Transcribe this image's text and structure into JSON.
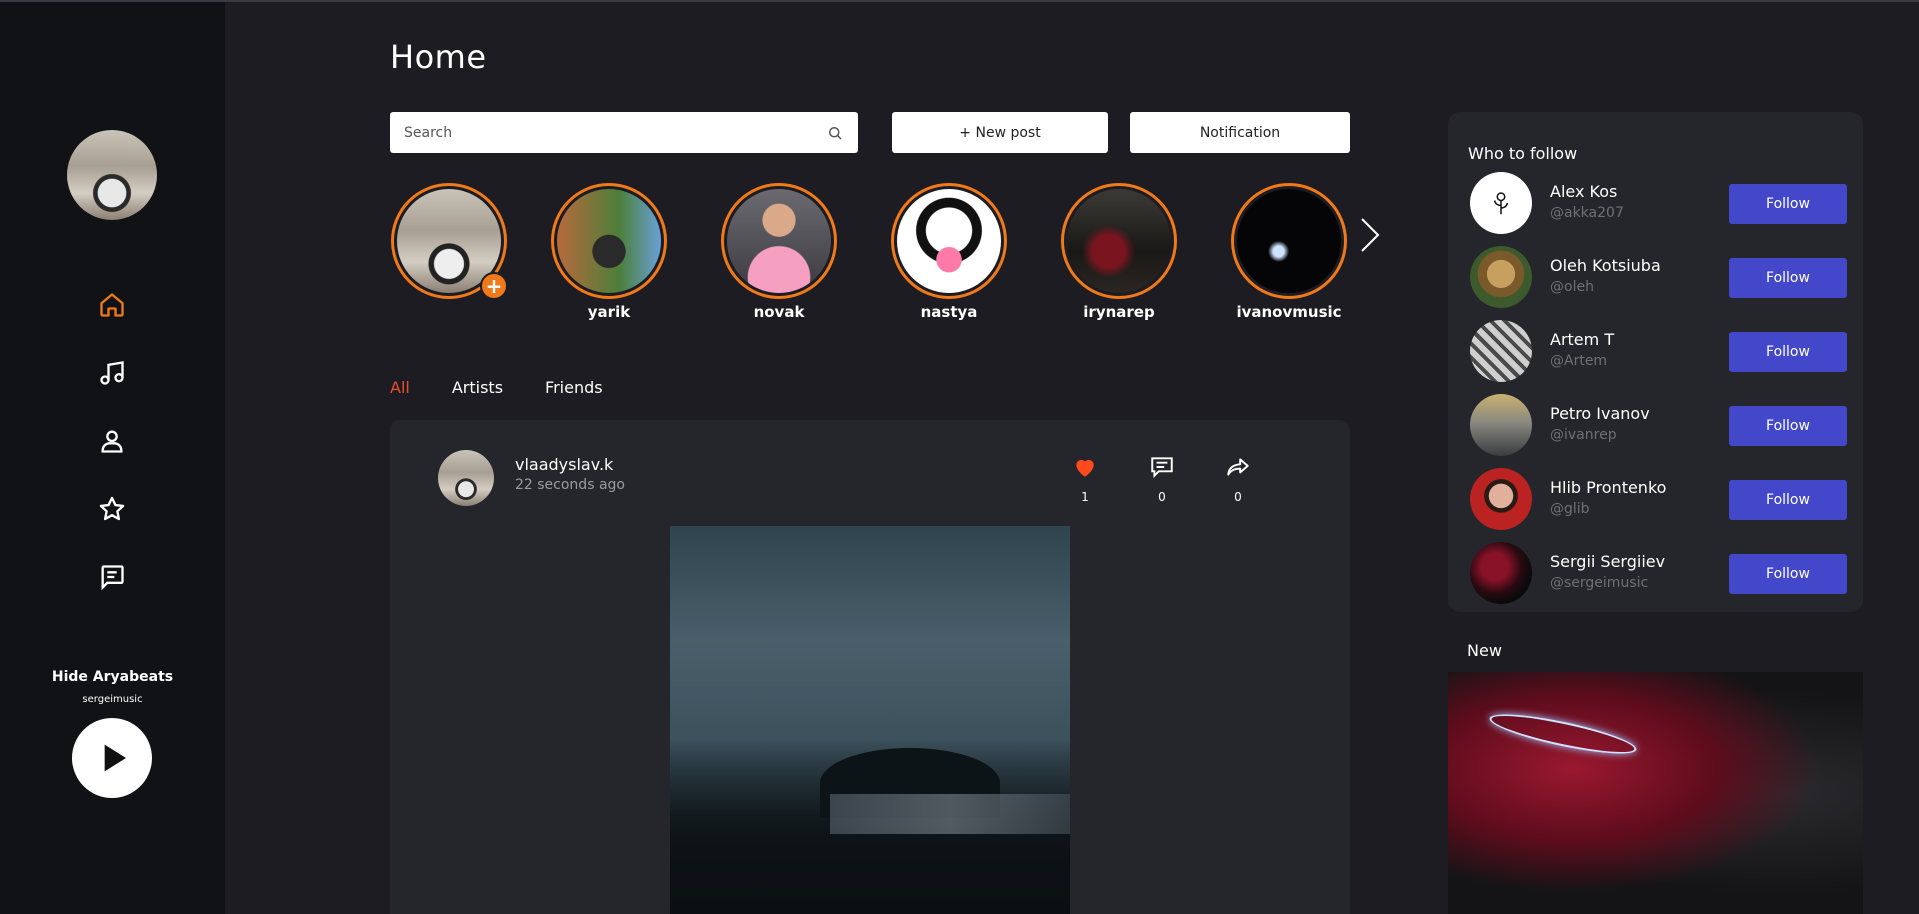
{
  "sidebar": {
    "nav": [
      {
        "icon": "home-icon",
        "active": true
      },
      {
        "icon": "music-note-icon",
        "active": false
      },
      {
        "icon": "profile-icon",
        "active": false
      },
      {
        "icon": "star-icon",
        "active": false
      },
      {
        "icon": "message-icon",
        "active": false
      }
    ],
    "player": {
      "track_title": "Hide Aryabeats",
      "artist": "sergeimusic",
      "play_icon": "play-icon"
    }
  },
  "header": {
    "title": "Home"
  },
  "toolbar": {
    "search_placeholder": "Search",
    "new_post_label": "+ New post",
    "notification_label": "Notification"
  },
  "stories": [
    {
      "name": "",
      "own": true
    },
    {
      "name": "yarik"
    },
    {
      "name": "novak"
    },
    {
      "name": "nastya"
    },
    {
      "name": "irynarep"
    },
    {
      "name": "ivanovmusic"
    }
  ],
  "tabs": [
    {
      "label": "All",
      "active": true
    },
    {
      "label": "Artists",
      "active": false
    },
    {
      "label": "Friends",
      "active": false
    }
  ],
  "post": {
    "username": "vlaadyslav.k",
    "time": "22 seconds ago",
    "likes": "1",
    "comments": "0",
    "shares": "0"
  },
  "who_to_follow": {
    "title": "Who to follow",
    "button_label": "Follow",
    "users": [
      {
        "name": "Alex Kos",
        "handle": "@akka207"
      },
      {
        "name": "Oleh Kotsiuba",
        "handle": "@oleh"
      },
      {
        "name": "Artem T",
        "handle": "@Artem"
      },
      {
        "name": "Petro Ivanov",
        "handle": "@ivanrep"
      },
      {
        "name": "Hlib Prontenko",
        "handle": "@glib"
      },
      {
        "name": "Sergii Sergiiev",
        "handle": "@sergeimusic"
      }
    ]
  },
  "new_section": {
    "title": "New"
  },
  "colors": {
    "accent_orange": "#f07a1a",
    "tab_active": "#e8502a",
    "follow_button": "#4347c9",
    "like_red": "#ff4a1c"
  }
}
